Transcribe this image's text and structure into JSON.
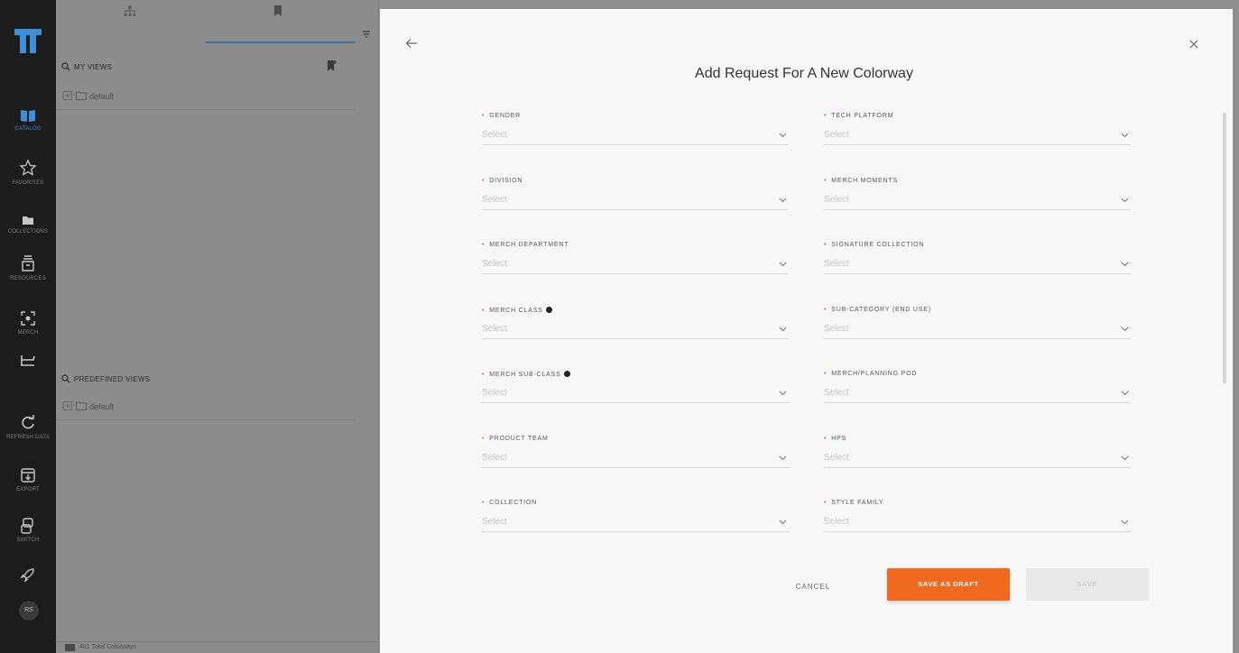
{
  "rail": {
    "items": [
      {
        "label": "CATALOG"
      },
      {
        "label": "FAVORITES"
      },
      {
        "label": "COLLECTIONS"
      },
      {
        "label": "RESOURCES"
      },
      {
        "label": "MERCH"
      },
      {
        "label": ""
      },
      {
        "label": "REFRESH DATA"
      },
      {
        "label": "EXPORT"
      },
      {
        "label": "SWITCH"
      },
      {
        "label": ""
      }
    ],
    "avatar": "RS",
    "accent": "#3d8fd8"
  },
  "panel": {
    "my_views": {
      "title": "MY VIEWS",
      "items": [
        "default"
      ]
    },
    "predefined_views": {
      "title": "PREDEFINED VIEWS",
      "items": [
        "default"
      ]
    },
    "footer": "481 Total Colorways"
  },
  "modal": {
    "title": "Add Request For A New Colorway",
    "placeholder": "Select",
    "left_fields": [
      {
        "label": "GENDER",
        "info": false
      },
      {
        "label": "DIVISION",
        "info": false
      },
      {
        "label": "MERCH DEPARTMENT",
        "info": false
      },
      {
        "label": "MERCH CLASS",
        "info": true
      },
      {
        "label": "MERCH SUB-CLASS",
        "info": true
      },
      {
        "label": "PRODUCT TEAM",
        "info": false
      },
      {
        "label": "COLLECTION",
        "info": false
      }
    ],
    "right_fields": [
      {
        "label": "TECH PLATFORM"
      },
      {
        "label": "MERCH MOMENTS"
      },
      {
        "label": "SIGNATURE COLLECTION"
      },
      {
        "label": "SUB-CATEGORY (END USE)"
      },
      {
        "label": "MERCH/PLANNING POD"
      },
      {
        "label": "HPS"
      },
      {
        "label": "STYLE FAMILY"
      }
    ],
    "required_mark": "•",
    "buttons": {
      "cancel": "CANCEL",
      "save_draft": "SAVE AS DRAFT",
      "save": "SAVE"
    },
    "colors": {
      "primary": "#ef6a1e",
      "required": "#e15a4a"
    }
  }
}
